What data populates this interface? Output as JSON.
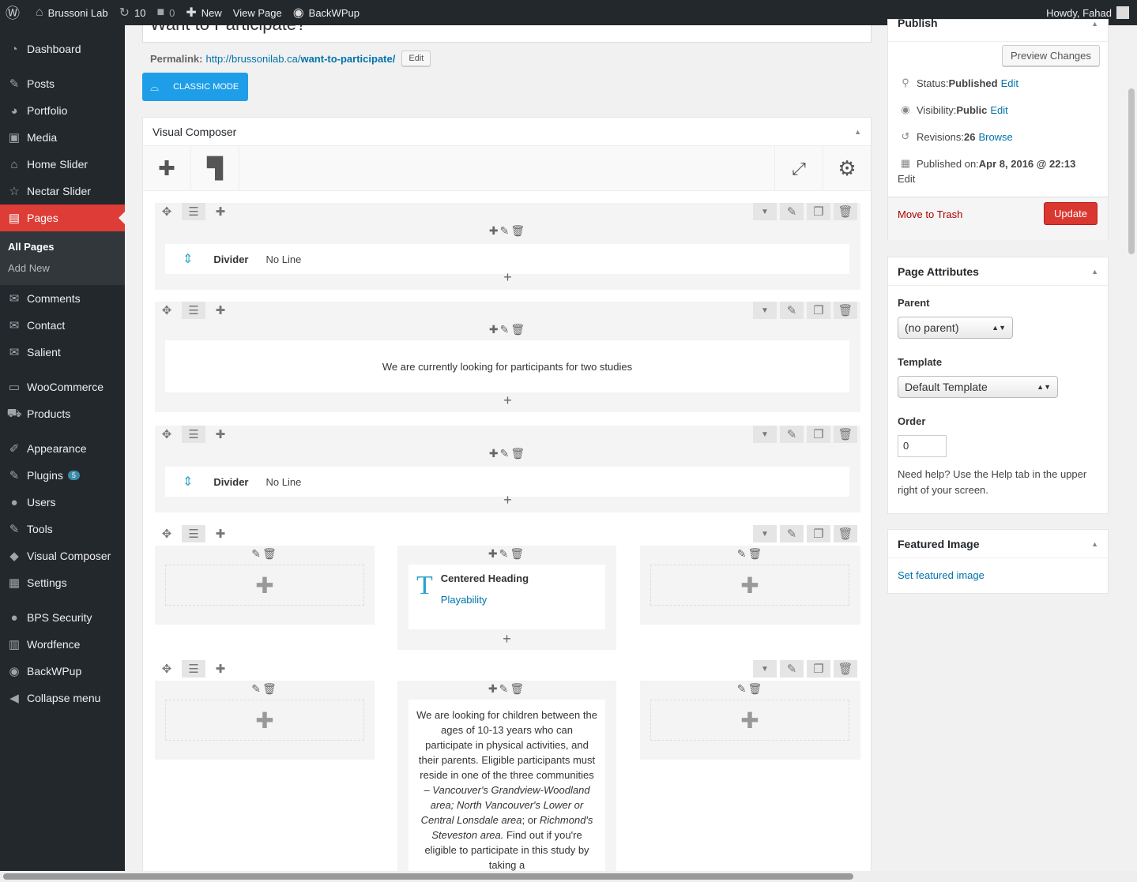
{
  "adminbar": {
    "site": "Brussoni Lab",
    "updates": "10",
    "comments": "0",
    "new": "New",
    "view": "View Page",
    "backwpup": "BackWPup",
    "howdy": "Howdy, Fahad"
  },
  "sidebar": {
    "items": [
      {
        "label": "Dashboard",
        "icon": "dashboard-icon",
        "glyph": "◔"
      },
      {
        "label": "Posts",
        "icon": "pin-icon",
        "glyph": "✎"
      },
      {
        "label": "Portfolio",
        "icon": "portfolio-icon",
        "glyph": "◕"
      },
      {
        "label": "Media",
        "icon": "media-icon",
        "glyph": "▣"
      },
      {
        "label": "Home Slider",
        "icon": "home-icon",
        "glyph": "⌂"
      },
      {
        "label": "Nectar Slider",
        "icon": "star-icon",
        "glyph": "☆"
      },
      {
        "label": "Pages",
        "icon": "pages-icon",
        "glyph": "▤"
      },
      {
        "label": "Comments",
        "icon": "comment-icon",
        "glyph": "✉"
      },
      {
        "label": "Contact",
        "icon": "mail-icon",
        "glyph": "✉"
      },
      {
        "label": "Salient",
        "icon": "salient-icon",
        "glyph": "✉"
      },
      {
        "label": "WooCommerce",
        "icon": "woo-icon",
        "glyph": "▭"
      },
      {
        "label": "Products",
        "icon": "cart-icon",
        "glyph": "⛟"
      },
      {
        "label": "Appearance",
        "icon": "brush-icon",
        "glyph": "✐"
      },
      {
        "label": "Plugins",
        "icon": "plugin-icon",
        "glyph": "✎",
        "badge": "5"
      },
      {
        "label": "Users",
        "icon": "user-icon",
        "glyph": "●"
      },
      {
        "label": "Tools",
        "icon": "wrench-icon",
        "glyph": "✎"
      },
      {
        "label": "Visual Composer",
        "icon": "vc-icon",
        "glyph": "◆"
      },
      {
        "label": "Settings",
        "icon": "settings-icon",
        "glyph": "▦"
      },
      {
        "label": "BPS Security",
        "icon": "bps-icon",
        "glyph": "●"
      },
      {
        "label": "Wordfence",
        "icon": "wordfence-icon",
        "glyph": "▥"
      },
      {
        "label": "BackWPup",
        "icon": "backwpup-icon",
        "glyph": "◉"
      },
      {
        "label": "Collapse menu",
        "icon": "collapse-icon",
        "glyph": "◀"
      }
    ],
    "submenu": [
      "All Pages",
      "Add New"
    ]
  },
  "editor": {
    "title": "Want to Participate?",
    "permalink_label": "Permalink:",
    "permalink_base": "http://brussonilab.ca/",
    "permalink_slug": "want-to-participate/",
    "edit": "Edit",
    "classic_mode": "CLASSIC MODE"
  },
  "vc": {
    "title": "Visual Composer",
    "divider_name": "Divider",
    "divider_value": "No Line",
    "text1": "We are currently looking for participants for two studies",
    "heading_name": "Centered Heading",
    "heading_link": "Playability",
    "text2_a": "We are looking for children between the ages of 10-13 years who can participate in physical activities, and their parents. Eligible participants must reside in one of the three communities – ",
    "text2_b": "Vancouver's Grandview-Woodland area; North Vancouver's Lower or Central Lonsdale area",
    "text2_c": "; or ",
    "text2_d": "Richmond's Steveston area.",
    "text2_e": " Find out if you're eligible to participate in this study by taking a"
  },
  "publish": {
    "title": "Publish",
    "preview": "Preview Changes",
    "status_label": "Status: ",
    "status": "Published",
    "visibility_label": "Visibility: ",
    "visibility": "Public",
    "revisions_label": "Revisions: ",
    "revisions": "26",
    "browse": "Browse",
    "published_label": "Published on: ",
    "published": "Apr 8, 2016 @ 22:13",
    "edit": "Edit",
    "trash": "Move to Trash",
    "update": "Update"
  },
  "attributes": {
    "title": "Page Attributes",
    "parent_label": "Parent",
    "parent": "(no parent)",
    "template_label": "Template",
    "template": "Default Template",
    "order_label": "Order",
    "order": "0",
    "help": "Need help? Use the Help tab in the upper right of your screen."
  },
  "featured": {
    "title": "Featured Image",
    "link": "Set featured image"
  },
  "colors": {
    "accent": "#dd3d36",
    "link": "#0073aa",
    "classic": "#1e9ee8",
    "update": "#d9372f"
  }
}
